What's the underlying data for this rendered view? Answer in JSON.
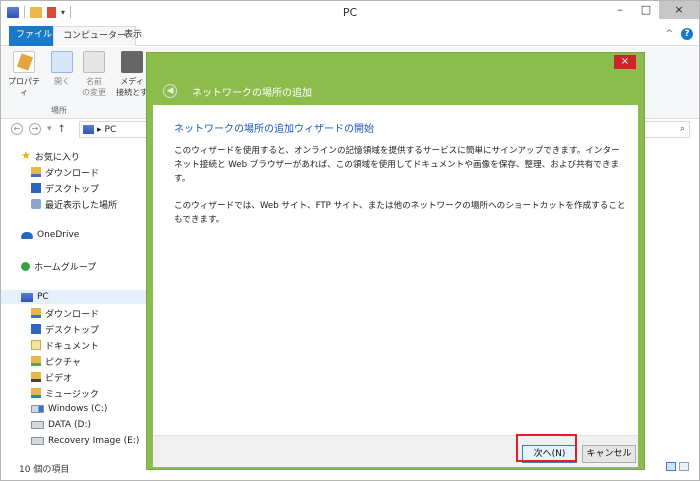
{
  "window": {
    "title": "PC",
    "min": "–",
    "max": "□",
    "close": "×"
  },
  "tabs": {
    "file": "ファイル",
    "computer": "コンピューター",
    "view": "表示",
    "collapse": "^",
    "help": "?"
  },
  "ribbon": {
    "items": [
      {
        "label1": "プロパティ",
        "label2": ""
      },
      {
        "label1": "開く",
        "label2": ""
      },
      {
        "label1": "名前",
        "label2": "の変更"
      },
      {
        "label1": "メディ",
        "label2": "接続とす"
      }
    ],
    "group": "場所"
  },
  "address": {
    "path": "PC",
    "separator": "▸",
    "search_icon": "⌕"
  },
  "nav": {
    "favorites": "お気に入り",
    "downloads": "ダウンロード",
    "desktop": "デスクトップ",
    "recent": "最近表示した場所",
    "onedrive": "OneDrive",
    "homegroup": "ホームグループ",
    "pc": "PC",
    "pc_downloads": "ダウンロード",
    "pc_desktop": "デスクトップ",
    "documents": "ドキュメント",
    "pictures": "ピクチャ",
    "videos": "ビデオ",
    "music": "ミュージック",
    "drive_c": "Windows (C:)",
    "drive_d": "DATA (D:)",
    "drive_e": "Recovery Image (E:)"
  },
  "status": {
    "count": "10 個の項目"
  },
  "wizard": {
    "title": "ネットワークの場所の追加",
    "close": "×",
    "back": "◀",
    "heading": "ネットワークの場所の追加ウィザードの開始",
    "para1": "このウィザードを使用すると、オンラインの記憶領域を提供するサービスに簡単にサインアップできます。インターネット接続と Web ブラウザーがあれば、この領域を使用してドキュメントや画像を保存、整理、および共有できます。",
    "para2": "このウィザードでは、Web サイト、FTP サイト、または他のネットワークの場所へのショートカットを作成することもできます。",
    "next": "次へ(N)",
    "cancel": "キャンセル"
  }
}
